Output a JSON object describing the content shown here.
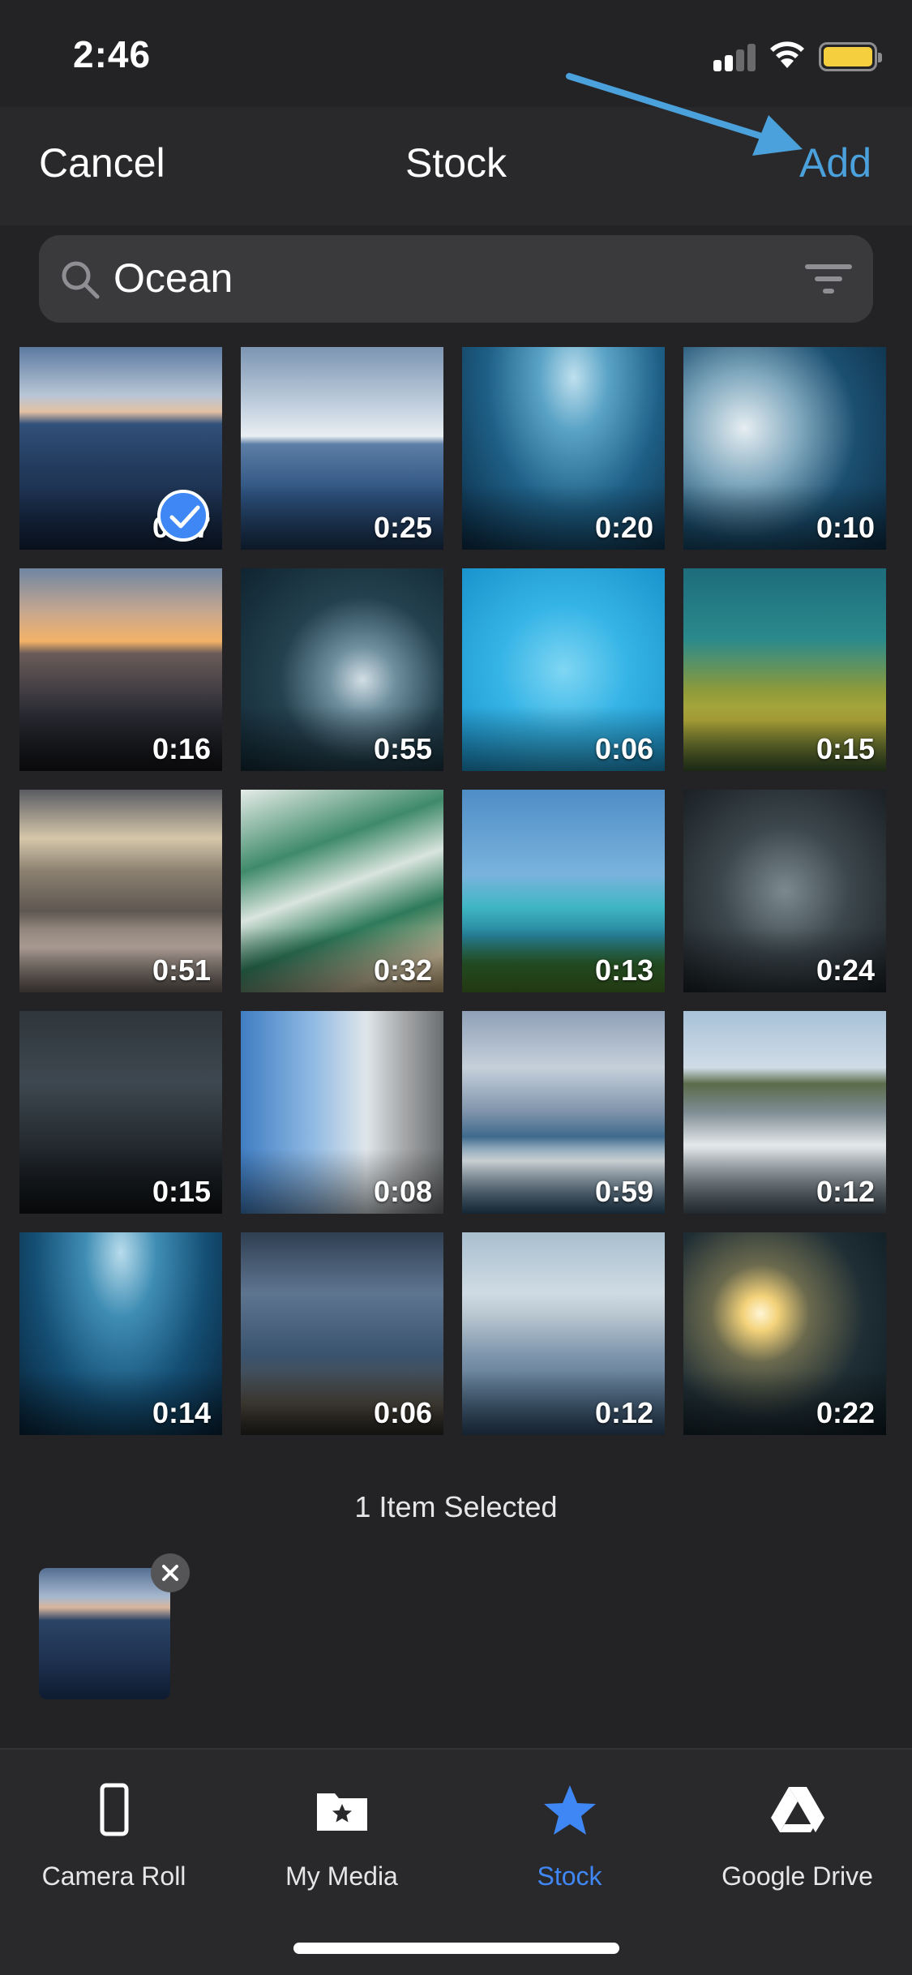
{
  "status_bar": {
    "time": "2:46"
  },
  "nav": {
    "cancel_label": "Cancel",
    "title": "Stock",
    "add_label": "Add"
  },
  "search": {
    "value": "Ocean"
  },
  "grid": {
    "items": [
      {
        "duration": "0:17",
        "selected": true,
        "icon": "ocean-horizon-sunset"
      },
      {
        "duration": "0:25",
        "icon": "sea-sunlight"
      },
      {
        "duration": "0:20",
        "icon": "underwater-light-rays"
      },
      {
        "duration": "0:10",
        "icon": "foaming-waves"
      },
      {
        "duration": "0:16",
        "icon": "ocean-sunset"
      },
      {
        "duration": "0:55",
        "icon": "dark-surf-aerial"
      },
      {
        "duration": "0:06",
        "icon": "pool-caustics"
      },
      {
        "duration": "0:15",
        "icon": "coral-reef"
      },
      {
        "duration": "0:51",
        "icon": "beach-shore-sun"
      },
      {
        "duration": "0:32",
        "icon": "aerial-beach-waves"
      },
      {
        "duration": "0:13",
        "icon": "palm-trees-sailboat"
      },
      {
        "duration": "0:24",
        "icon": "shimmering-water"
      },
      {
        "duration": "0:15",
        "icon": "dark-ocean"
      },
      {
        "duration": "0:08",
        "icon": "tropical-palms-curtain"
      },
      {
        "duration": "0:59",
        "icon": "cloudy-ocean-waves"
      },
      {
        "duration": "0:12",
        "icon": "rocky-coast-surf"
      },
      {
        "duration": "0:14",
        "icon": "underwater-rays"
      },
      {
        "duration": "0:06",
        "icon": "person-on-rock"
      },
      {
        "duration": "0:12",
        "icon": "calm-sea-dusk"
      },
      {
        "duration": "0:22",
        "icon": "sun-over-water"
      }
    ]
  },
  "tray": {
    "label": "1 Item Selected"
  },
  "tabs": [
    {
      "label": "Camera Roll",
      "icon": "phone-icon"
    },
    {
      "label": "My Media",
      "icon": "folder-star-icon"
    },
    {
      "label": "Stock",
      "icon": "star-icon",
      "active": true
    },
    {
      "label": "Google Drive",
      "icon": "google-drive-icon"
    }
  ],
  "colors": {
    "accent": "#4aa1dc",
    "active_tab": "#3f87f5",
    "background": "#232326",
    "bar": "#29292c"
  }
}
